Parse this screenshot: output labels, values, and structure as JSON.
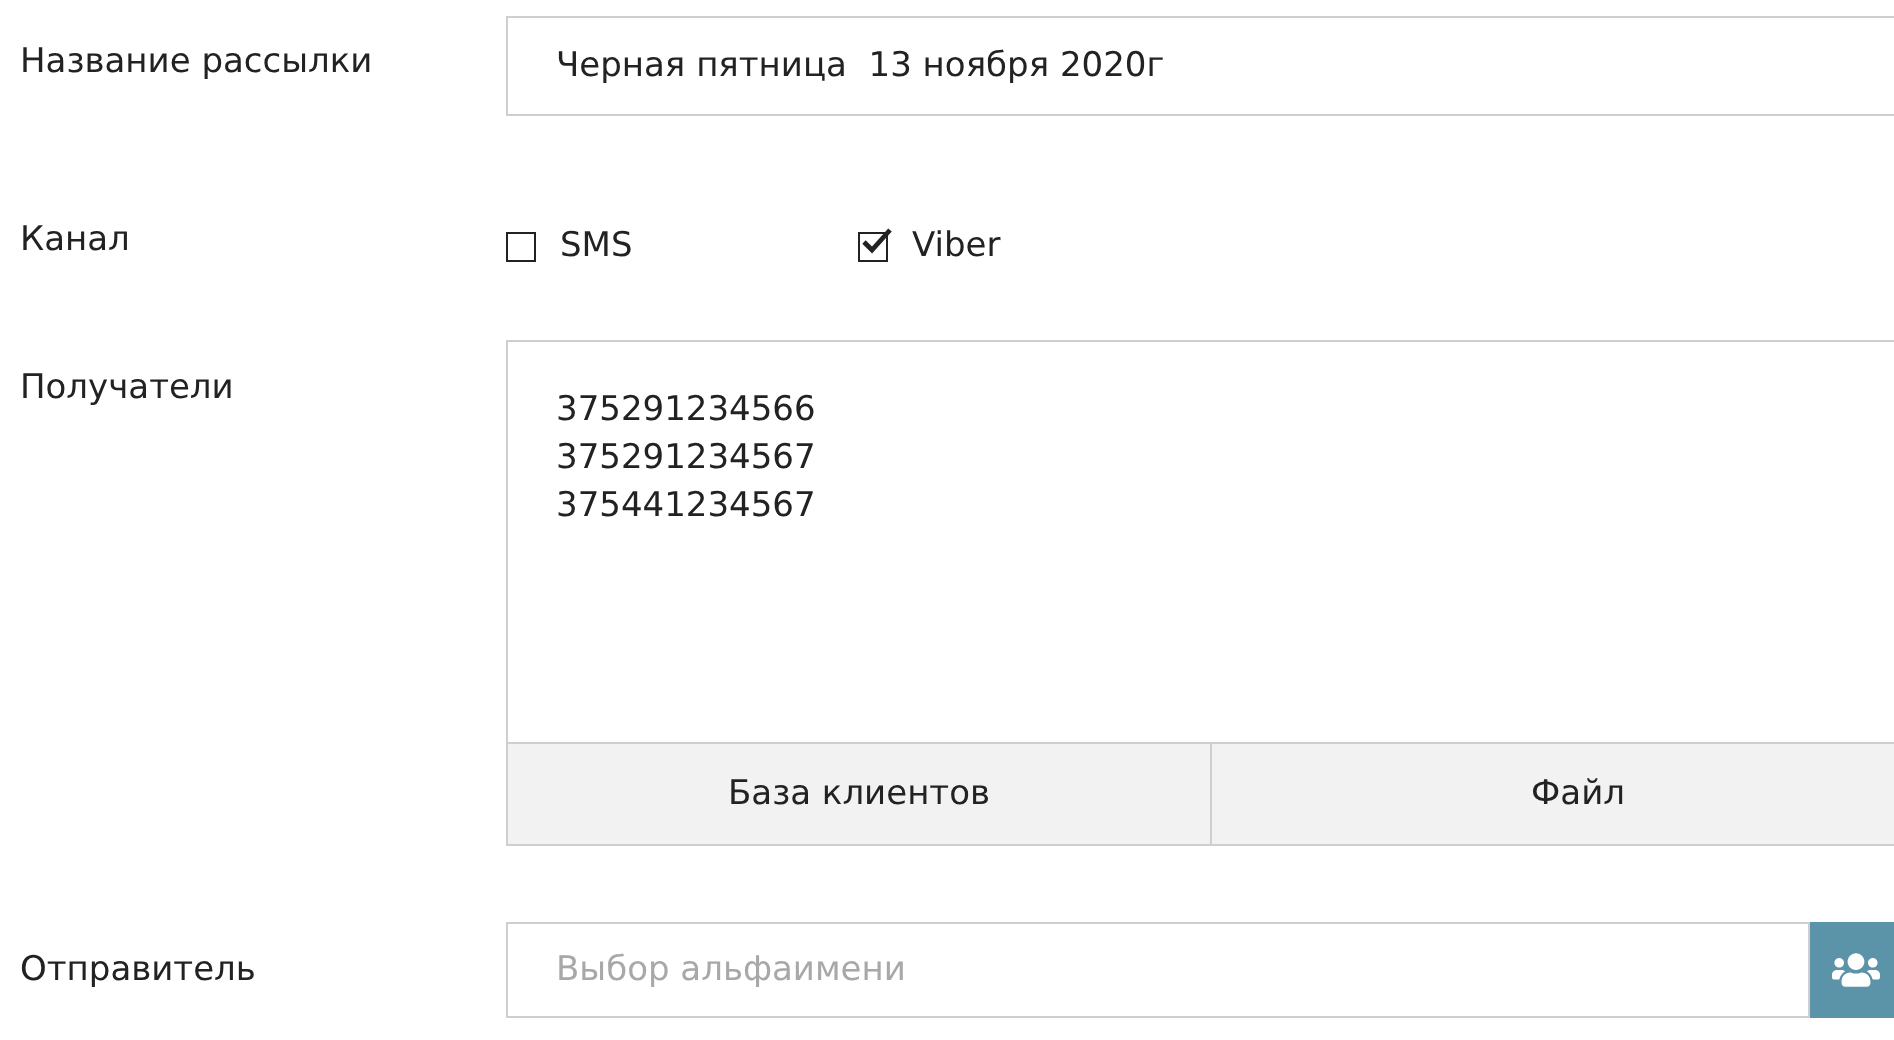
{
  "name_row": {
    "label": "Название рассылки",
    "value": "Черная пятница  13 ноября 2020г"
  },
  "channel_row": {
    "label": "Канал",
    "options": [
      {
        "label": "SMS",
        "checked": false
      },
      {
        "label": "Viber",
        "checked": true
      }
    ]
  },
  "recipients_row": {
    "label": "Получатели",
    "lines": [
      "375291234566",
      "375291234567",
      "375441234567"
    ],
    "buttons": [
      "База клиентов",
      "Файл"
    ]
  },
  "sender_row": {
    "label": "Отправитель",
    "placeholder": "Выбор альфаимени"
  }
}
